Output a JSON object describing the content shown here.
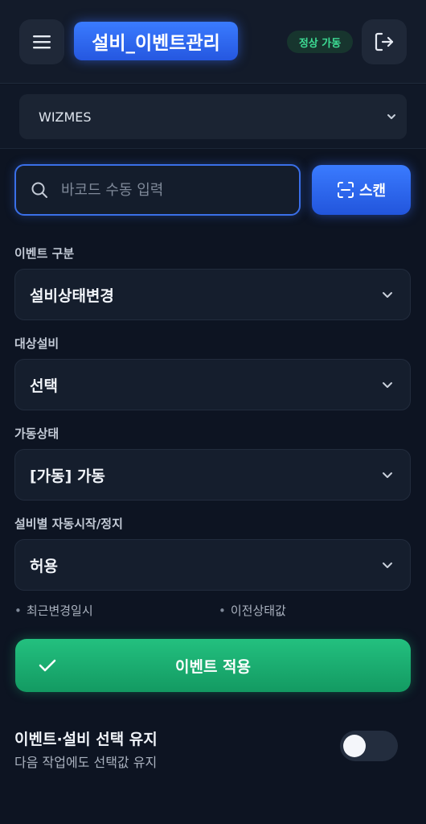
{
  "header": {
    "title": "설비_이벤트관리",
    "status_badge": "정상 가동",
    "menu_icon": "hamburger-menu-icon",
    "logout_icon": "logout-icon"
  },
  "site": {
    "selected": "WIZMES"
  },
  "barcode": {
    "placeholder": "바코드 수동 입력",
    "value": "",
    "scan_label": "스캔"
  },
  "form": {
    "event_type": {
      "label": "이벤트 구분",
      "value": "설비상태변경"
    },
    "target_equipment": {
      "label": "대상설비",
      "value": "선택"
    },
    "operation_status": {
      "label": "가동상태",
      "value": "[가동] 가동"
    },
    "auto_start_stop": {
      "label": "설비별 자동시작/정지",
      "value": "허용"
    }
  },
  "info": {
    "last_changed": "최근변경일시",
    "previous_status": "이전상태값"
  },
  "apply_button": {
    "label": "이벤트 적용"
  },
  "keep_selection": {
    "title": "이벤트·설비 선택 유지",
    "subtitle": "다음 작업에도 선택값 유지",
    "enabled": false
  },
  "colors": {
    "background": "#0d1422",
    "accent_blue": "#2f6bff",
    "accent_green": "#1db373",
    "status_green": "#3ddc94"
  }
}
